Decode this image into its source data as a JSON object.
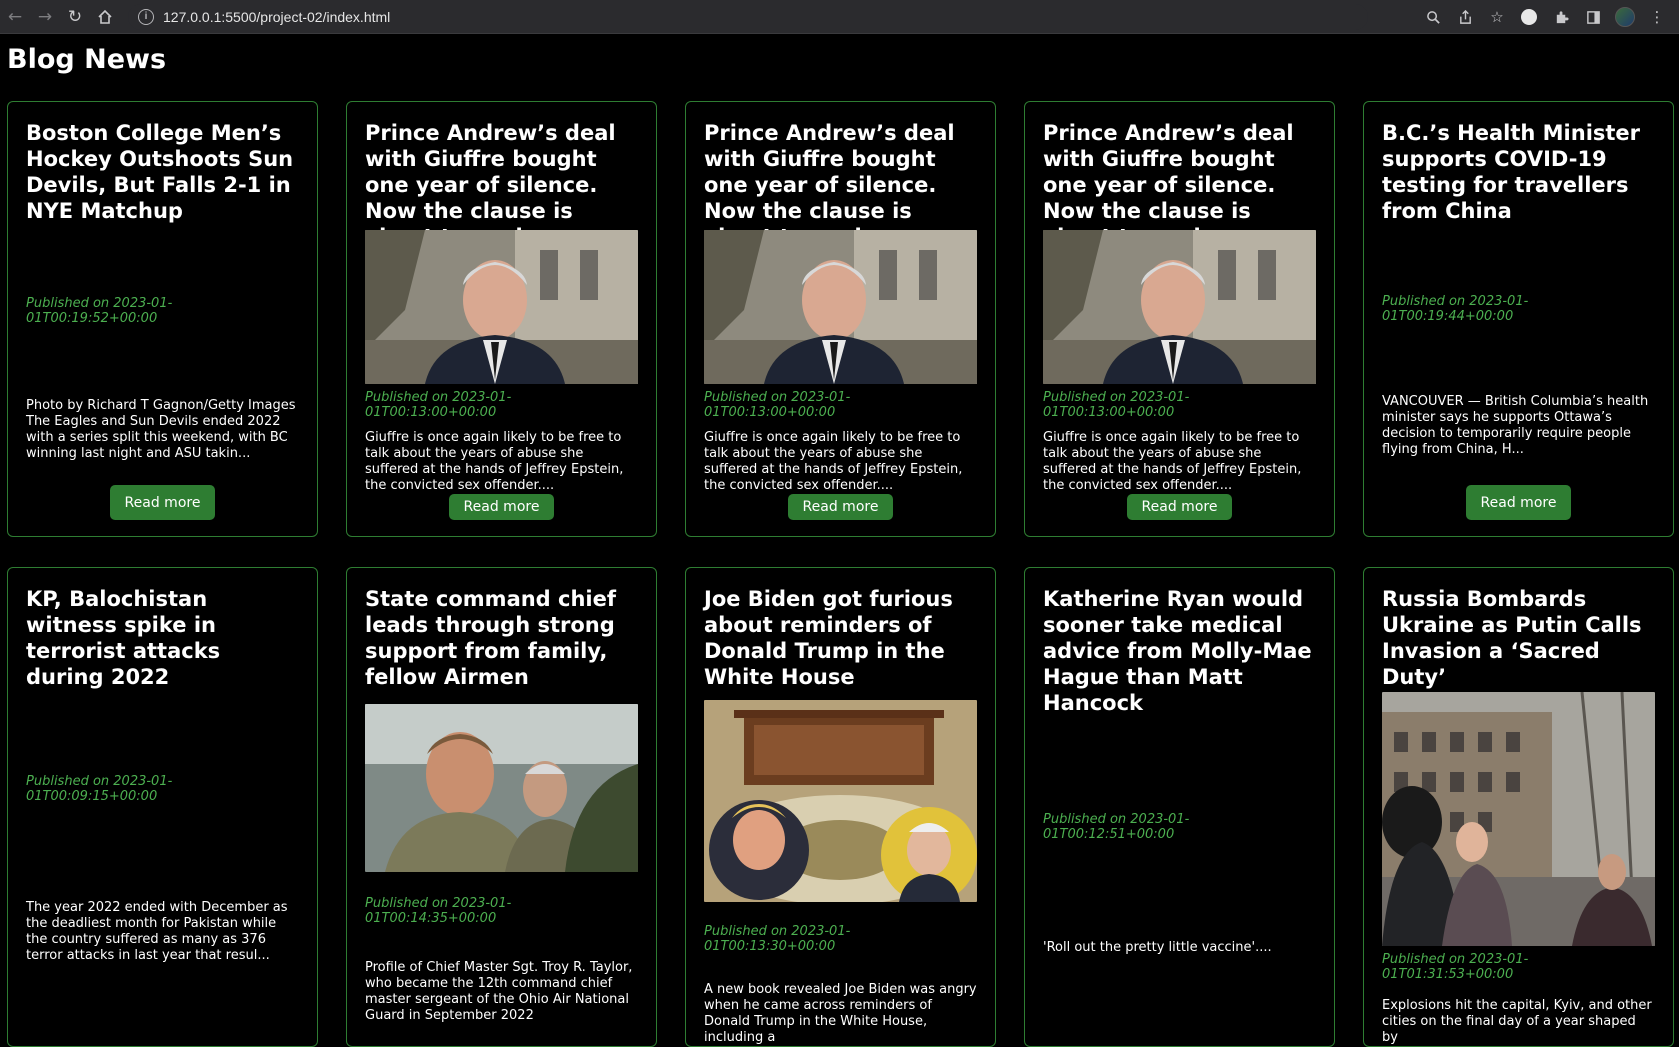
{
  "browser": {
    "url": "127.0.0.1:5500/project-02/index.html",
    "icons": [
      "back-arrow-icon",
      "forward-arrow-icon",
      "reload-icon",
      "home-icon",
      "info-icon",
      "zoom-icon",
      "share-icon",
      "star-icon",
      "extensions-icon",
      "sidebar-icon",
      "menu-icon"
    ]
  },
  "page": {
    "title": "Blog News"
  },
  "colors": {
    "background": "#000000",
    "accent_green": "#2e7d32",
    "date_green": "#4caf50",
    "text": "#ffffff"
  },
  "articles": [
    {
      "title": "Boston College Men’s Hockey Outshoots Sun Devils, But Falls 2-1 in NYE Matchup",
      "has_image": false,
      "date": "Published on 2023-01-01T00:19:52+00:00",
      "excerpt": "Photo by Richard T Gagnon/Getty Images The Eagles and Sun Devils ended 2022 with a series split this weekend, with BC winning last night and ASU takin...",
      "button": "Read more"
    },
    {
      "title": "Prince Andrew’s deal with Giuffre bought one year of silence. Now the clause is about to expire",
      "has_image": true,
      "image_subject": "prince-andrew-photo",
      "date": "Published on 2023-01-01T00:13:00+00:00",
      "excerpt": "Giuffre is once again likely to be free to talk about the years of abuse she suffered at the hands of Jeffrey Epstein, the convicted sex offender....",
      "button": "Read more"
    },
    {
      "title": "Prince Andrew’s deal with Giuffre bought one year of silence. Now the clause is about to expire",
      "has_image": true,
      "image_subject": "prince-andrew-photo",
      "date": "Published on 2023-01-01T00:13:00+00:00",
      "excerpt": "Giuffre is once again likely to be free to talk about the years of abuse she suffered at the hands of Jeffrey Epstein, the convicted sex offender....",
      "button": "Read more"
    },
    {
      "title": "Prince Andrew’s deal with Giuffre bought one year of silence. Now the clause is about to expire",
      "has_image": true,
      "image_subject": "prince-andrew-photo",
      "date": "Published on 2023-01-01T00:13:00+00:00",
      "excerpt": "Giuffre is once again likely to be free to talk about the years of abuse she suffered at the hands of Jeffrey Epstein, the convicted sex offender....",
      "button": "Read more"
    },
    {
      "title": "B.C.’s Health Minister supports COVID-19 testing for travellers from China",
      "has_image": false,
      "date": "Published on 2023-01-01T00:19:44+00:00",
      "excerpt": "VANCOUVER — British Columbia’s health minister says he supports Ottawa’s decision to temporarily require people flying from China, H...",
      "button": "Read more"
    },
    {
      "title": "KP, Balochistan witness spike in terrorist attacks during 2022",
      "has_image": false,
      "date": "Published on 2023-01-01T00:09:15+00:00",
      "excerpt": "The year 2022 ended with December as the deadliest month for Pakistan while the country suffered as many as 376 terror attacks in last year that resul..."
    },
    {
      "title": "State command chief leads through strong support from family, fellow Airmen",
      "has_image": true,
      "image_subject": "airmen-photo",
      "date": "Published on 2023-01-01T00:14:35+00:00",
      "excerpt": "Profile of Chief Master Sgt. Troy R. Taylor, who became the 12th command chief master sergeant of the Ohio Air National Guard in September 2022"
    },
    {
      "title": "Joe Biden got furious about reminders of Donald Trump in the White House",
      "has_image": true,
      "image_subject": "oval-office-photo",
      "date": "Published on 2023-01-01T00:13:30+00:00",
      "excerpt": "A new book revealed Joe Biden was angry when he came across reminders of Donald Trump in the White House, including a"
    },
    {
      "title": "Katherine Ryan would sooner take medical advice from Molly-Mae Hague than Matt Hancock",
      "has_image": false,
      "date": "Published on 2023-01-01T00:12:51+00:00",
      "excerpt": "'Roll out the pretty little vaccine'...."
    },
    {
      "title": "Russia Bombards Ukraine as Putin Calls Invasion a ‘Sacred Duty’",
      "has_image": true,
      "image_subject": "kyiv-street-photo",
      "date": "Published on 2023-01-01T01:31:53+00:00",
      "excerpt": "Explosions hit the capital, Kyiv, and other cities on the final day of a year shaped by"
    }
  ]
}
